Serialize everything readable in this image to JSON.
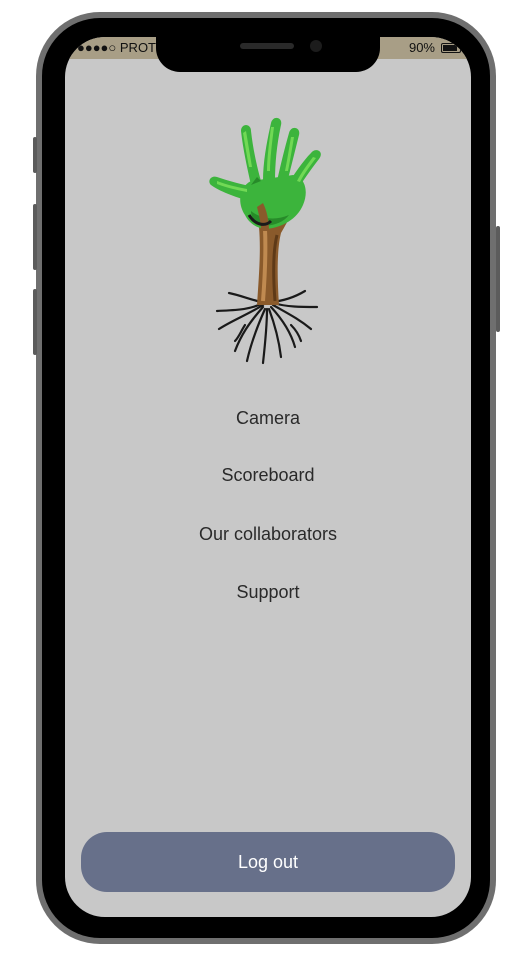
{
  "status_bar": {
    "carrier": "PROT",
    "signal_dots": "●●●●○",
    "battery_percent": "90%",
    "battery_level": 0.9
  },
  "menu": {
    "items": [
      {
        "label": "Camera"
      },
      {
        "label": "Scoreboard"
      },
      {
        "label": "Our collaborators"
      },
      {
        "label": "Support"
      }
    ]
  },
  "logout_label": "Log out",
  "colors": {
    "screen_bg": "#c8c8c8",
    "logout_bg": "#67708a",
    "status_bar_bg": "#a89e86",
    "leaf_green": "#3cb43c",
    "bark_brown": "#8a5a2b"
  },
  "icons": {
    "logo": "tree-hand-logo-icon",
    "battery": "battery-icon"
  }
}
